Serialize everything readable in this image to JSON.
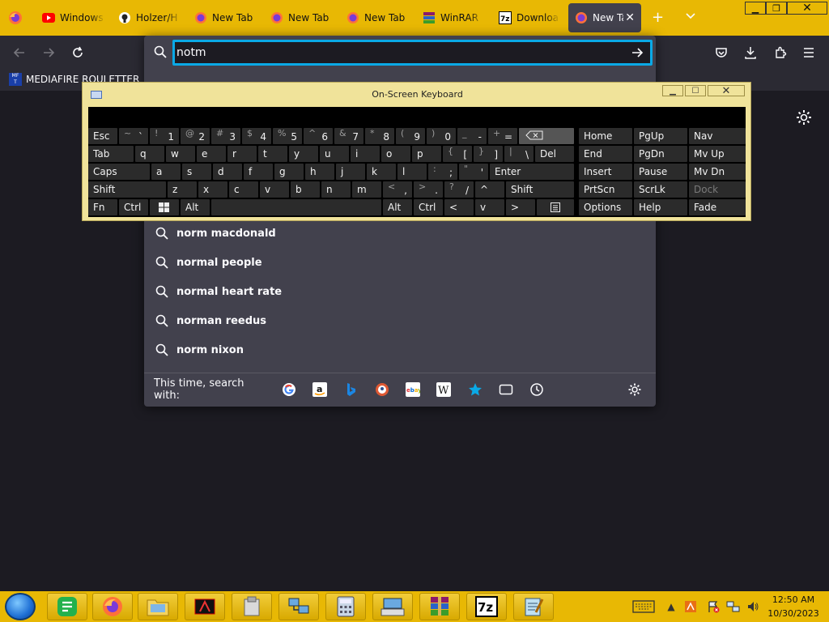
{
  "tabs": [
    {
      "label": "Windows",
      "icon": "youtube-icon"
    },
    {
      "label": "Holzer/H",
      "icon": "github-icon"
    },
    {
      "label": "New Tab",
      "icon": "firefox-icon"
    },
    {
      "label": "New Tab",
      "icon": "firefox-icon"
    },
    {
      "label": "New Tab",
      "icon": "firefox-icon"
    },
    {
      "label": "WinRAR",
      "icon": "winrar-icon"
    },
    {
      "label": "Downloa",
      "icon": "7zip-icon"
    },
    {
      "label": "New Ta",
      "icon": "firefox-icon"
    }
  ],
  "bookmark": {
    "label": "MEDIAFIRE ROULETTER"
  },
  "urlbar": {
    "value": "notm"
  },
  "suggestions": [
    "norm macdonald",
    "normal people",
    "normal heart rate",
    "norman reedus",
    "norm nixon"
  ],
  "oneoff": {
    "label": "This time, search with:"
  },
  "osk": {
    "title": "On-Screen Keyboard",
    "row1": [
      {
        "l": "Esc"
      },
      {
        "s": "~",
        "m": "`"
      },
      {
        "s": "!",
        "m": "1"
      },
      {
        "s": "@",
        "m": "2"
      },
      {
        "s": "#",
        "m": "3"
      },
      {
        "s": "$",
        "m": "4"
      },
      {
        "s": "%",
        "m": "5"
      },
      {
        "s": "^",
        "m": "6"
      },
      {
        "s": "&",
        "m": "7"
      },
      {
        "s": "*",
        "m": "8"
      },
      {
        "s": "(",
        "m": "9"
      },
      {
        "s": ")",
        "m": "0"
      },
      {
        "s": "_",
        "m": "-"
      },
      {
        "s": "+",
        "m": "="
      }
    ],
    "row2": [
      {
        "l": "Tab"
      },
      {
        "l": "q"
      },
      {
        "l": "w"
      },
      {
        "l": "e"
      },
      {
        "l": "r"
      },
      {
        "l": "t"
      },
      {
        "l": "y"
      },
      {
        "l": "u"
      },
      {
        "l": "i"
      },
      {
        "l": "o"
      },
      {
        "l": "p"
      },
      {
        "s": "{",
        "m": "["
      },
      {
        "s": "}",
        "m": "]"
      },
      {
        "s": "|",
        "m": "\\"
      },
      {
        "l": "Del"
      }
    ],
    "row3": [
      {
        "l": "Caps"
      },
      {
        "l": "a"
      },
      {
        "l": "s"
      },
      {
        "l": "d"
      },
      {
        "l": "f"
      },
      {
        "l": "g"
      },
      {
        "l": "h"
      },
      {
        "l": "j"
      },
      {
        "l": "k"
      },
      {
        "l": "l"
      },
      {
        "s": ":",
        "m": ";"
      },
      {
        "s": "\"",
        "m": "'"
      },
      {
        "l": "Enter"
      }
    ],
    "row4": [
      {
        "l": "Shift"
      },
      {
        "l": "z"
      },
      {
        "l": "x"
      },
      {
        "l": "c"
      },
      {
        "l": "v"
      },
      {
        "l": "b"
      },
      {
        "l": "n"
      },
      {
        "l": "m"
      },
      {
        "s": "<",
        "m": ","
      },
      {
        "s": ">",
        "m": "."
      },
      {
        "s": "?",
        "m": "/"
      },
      {
        "l": "^"
      },
      {
        "l": "Shift"
      }
    ],
    "row5": [
      {
        "l": "Fn"
      },
      {
        "l": "Ctrl"
      },
      {
        "l": "Alt"
      },
      {
        "l": "Alt"
      },
      {
        "l": "Ctrl"
      },
      {
        "l": "<"
      },
      {
        "l": "v"
      },
      {
        "l": ">"
      }
    ],
    "side": [
      [
        "Home",
        "PgUp",
        "Nav"
      ],
      [
        "End",
        "PgDn",
        "Mv Up"
      ],
      [
        "Insert",
        "Pause",
        "Mv Dn"
      ],
      [
        "PrtScn",
        "ScrLk",
        "Dock"
      ],
      [
        "Options",
        "Help",
        "Fade"
      ]
    ]
  },
  "clock": {
    "time": "12:50 AM",
    "date": "10/30/2023"
  },
  "colors": {
    "accent": "#0aa9e6",
    "tabstrip": "#e8b804",
    "panel": "#42414d"
  }
}
